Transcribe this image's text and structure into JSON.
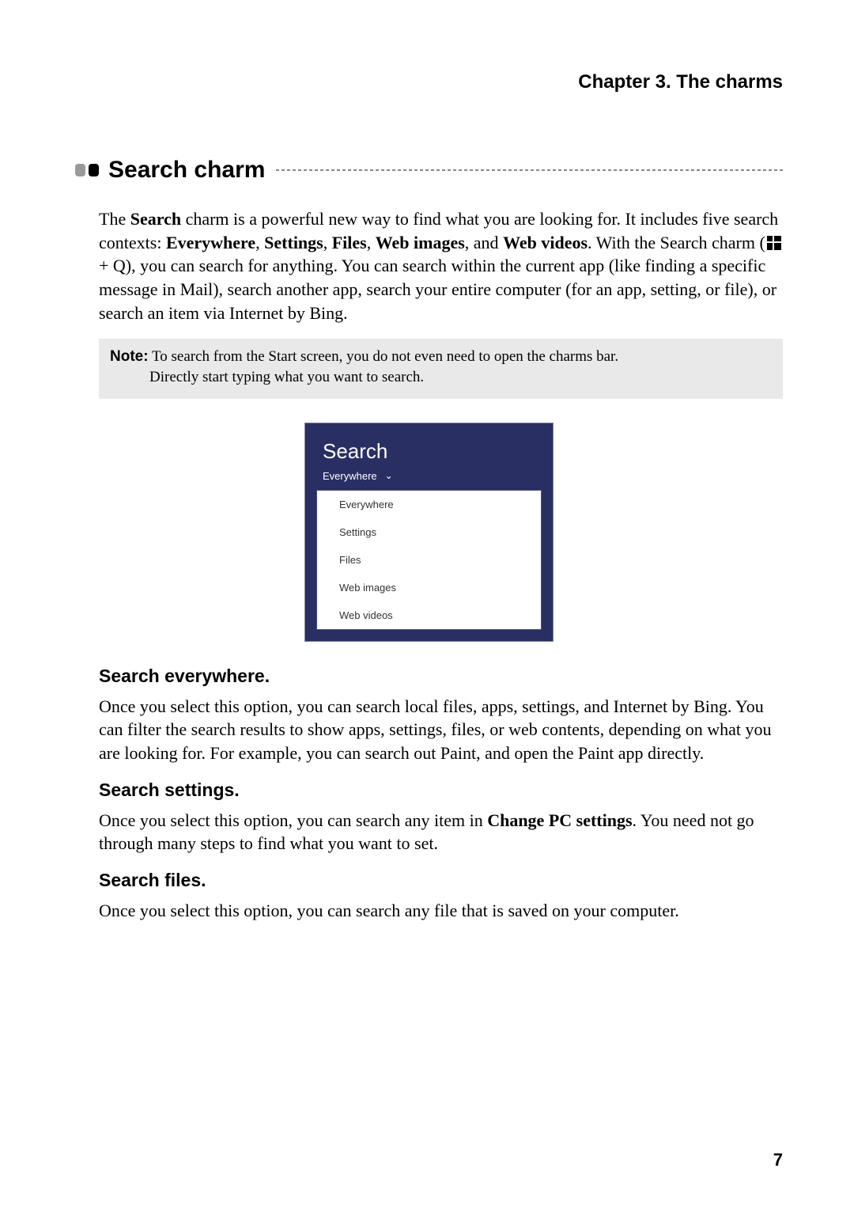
{
  "chapter_header": "Chapter 3. The charms",
  "section_title": "Search charm",
  "intro": {
    "p1_a": "The ",
    "p1_b": "Search",
    "p1_c": " charm is a powerful new way to find what you are looking for. It includes five search contexts: ",
    "ctx1": "Everywhere",
    "sep": ", ",
    "ctx2": "Settings",
    "ctx3": "Files",
    "ctx4": "Web images",
    "and": ", and ",
    "ctx5": "Web videos",
    "p2_a": ". With the Search charm (",
    "p2_key": " + Q), you can search for anything. You can search within the current app (like finding a specific message in Mail), search another app, search your entire computer (for an app, setting, or file), or search an item via Internet by Bing."
  },
  "note": {
    "label": "Note:",
    "line1": " To search from the Start screen, you do not even need to open the charms bar.",
    "line2": "Directly start typing what you want to search."
  },
  "screenshot": {
    "title": "Search",
    "selected": "Everywhere",
    "options": [
      "Everywhere",
      "Settings",
      "Files",
      "Web images",
      "Web videos"
    ]
  },
  "sub1": {
    "heading": "Search everywhere.",
    "body": "Once you select this option, you can search local files, apps, settings, and Internet by Bing. You can filter the search results to show apps, settings, files, or web contents, depending on what you are looking for. For example, you can search out Paint, and open the Paint app directly."
  },
  "sub2": {
    "heading": "Search settings.",
    "body_a": "Once you select this option, you can search any item in ",
    "body_b": "Change PC settings",
    "body_c": ". You need not go through many steps to find what you want to set."
  },
  "sub3": {
    "heading": "Search files.",
    "body": "Once you select this option, you can search any file that is saved on your computer."
  },
  "page_number": "7"
}
